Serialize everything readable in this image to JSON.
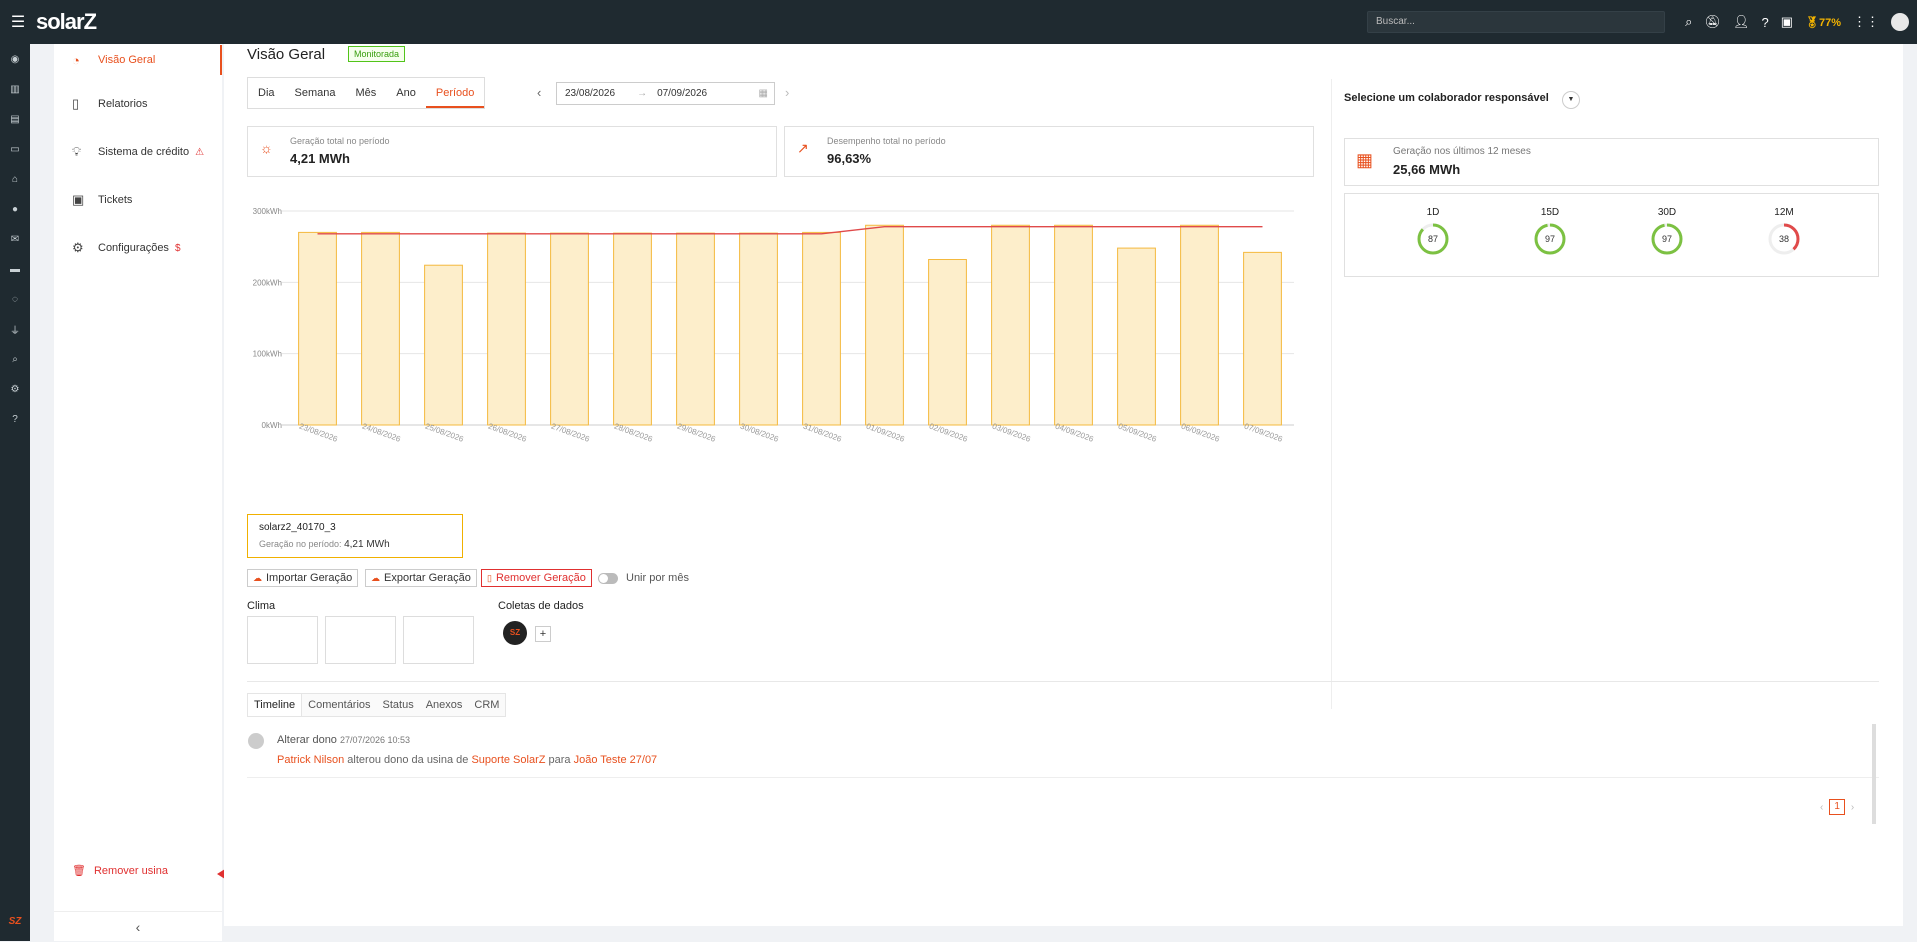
{
  "topbar": {
    "logo": "solarZ",
    "search_placeholder": "Buscar...",
    "battery_pct": "77%"
  },
  "sidebar": {
    "items": [
      {
        "label": "Visão Geral",
        "icon": "gauge-icon",
        "active": true
      },
      {
        "label": "Relatorios",
        "icon": "document-icon"
      },
      {
        "label": "Sistema de crédito",
        "icon": "lightbulb-icon",
        "warning": true
      },
      {
        "label": "Tickets",
        "icon": "ticket-icon"
      },
      {
        "label": "Configurações",
        "icon": "gear-icon",
        "dollar": true
      }
    ],
    "remove_label": "Remover usina",
    "collapse": "‹"
  },
  "header": {
    "title": "Visão Geral",
    "status": "Monitorada"
  },
  "period_tabs": [
    "Dia",
    "Semana",
    "Mês",
    "Ano",
    "Período"
  ],
  "dates": {
    "start": "23/08/2026",
    "end": "07/09/2026"
  },
  "summary": {
    "gen_label": "Geração total no período",
    "gen_value": "4,21 MWh",
    "perf_label": "Desempenho total no período",
    "perf_value": "96,63%"
  },
  "chart_data": {
    "type": "bar",
    "categories": [
      "23/08/2026",
      "24/08/2026",
      "25/08/2026",
      "26/08/2026",
      "27/08/2026",
      "28/08/2026",
      "29/08/2026",
      "30/08/2026",
      "31/08/2026",
      "01/09/2026",
      "02/09/2026",
      "03/09/2026",
      "04/09/2026",
      "05/09/2026",
      "06/09/2026",
      "07/09/2026"
    ],
    "values": [
      270,
      270,
      224,
      269,
      269,
      269,
      269,
      269,
      270,
      280,
      232,
      280,
      280,
      248,
      280,
      242
    ],
    "line": [
      268,
      268,
      268,
      268,
      268,
      268,
      268,
      268,
      268,
      278,
      278,
      278,
      278,
      278,
      278,
      278
    ],
    "yticks": [
      "0kWh",
      "100kWh",
      "200kWh",
      "300kWh"
    ],
    "ylim": [
      0,
      300
    ],
    "bar_color": "#fdeecb",
    "bar_border": "#f4b93e",
    "line_color": "#e04a4a"
  },
  "plant": {
    "name": "solarz2_40170_3",
    "gen_label": "Geração no período:",
    "gen_value": "4,21 MWh"
  },
  "actions": {
    "import": "Importar Geração",
    "export": "Exportar Geração",
    "remove": "Remover Geração",
    "toggle": "Unir por mês"
  },
  "sections": {
    "clima": "Clima",
    "coletas": "Coletas de dados",
    "coleta_logo": "SZ"
  },
  "right": {
    "select_title": "Selecione um colaborador responsável",
    "gen12_label": "Geração nos últimos 12 meses",
    "gen12_value": "25,66 MWh",
    "gauges": [
      {
        "label": "1D",
        "value": 87,
        "color": "#7cc142"
      },
      {
        "label": "15D",
        "value": 97,
        "color": "#7cc142"
      },
      {
        "label": "30D",
        "value": 97,
        "color": "#7cc142"
      },
      {
        "label": "12M",
        "value": 38,
        "color": "#e04a4a"
      }
    ]
  },
  "timeline": {
    "tabs": [
      "Timeline",
      "Comentários",
      "Status",
      "Anexos",
      "CRM"
    ],
    "entry_title": "Alterar dono",
    "entry_time": "27/07/2026 10:53",
    "user": "Patrick Nilson",
    "text1": " alterou dono da usina de ",
    "from": "Suporte SolarZ",
    "text2": " para ",
    "to": "João Teste 27/07"
  },
  "pager": {
    "page": "1"
  }
}
